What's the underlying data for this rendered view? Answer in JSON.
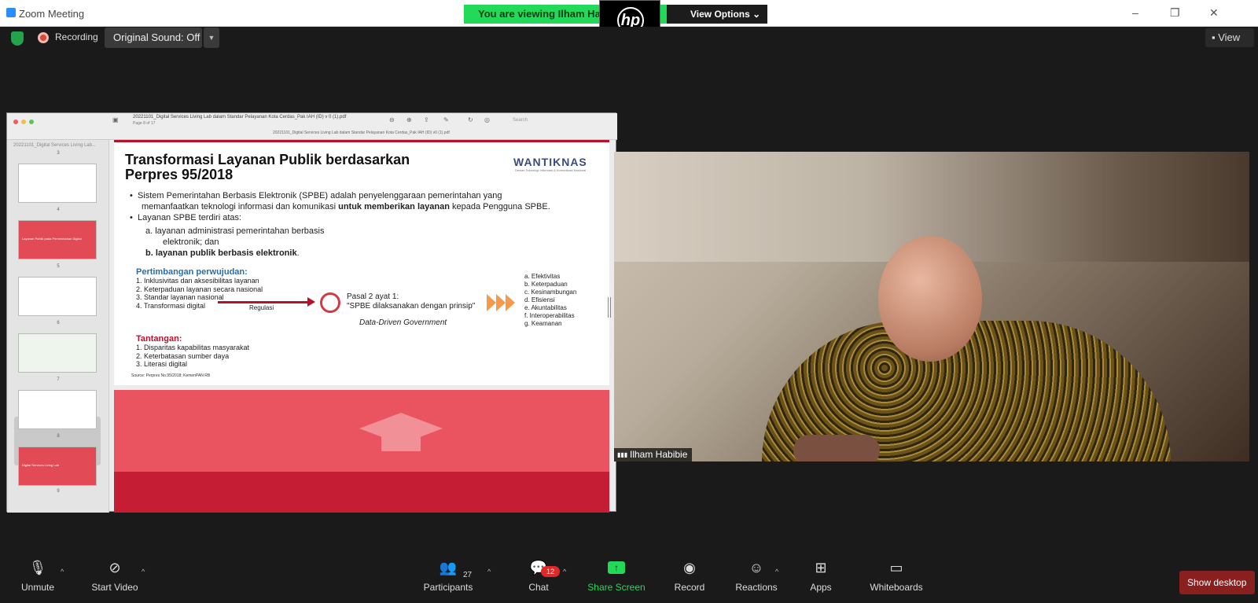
{
  "window": {
    "title": "Zoom Meeting",
    "minimize_glyph": "–",
    "restore_glyph": "❐",
    "close_glyph": "✕"
  },
  "banner": {
    "viewing_text": "You are viewing Ilham Habi",
    "view_options": "View Options ⌄",
    "hp_logo": "hp"
  },
  "meeting_bar": {
    "recording_label": "Recording",
    "original_sound": "Original Sound: Off",
    "view_label": "View"
  },
  "pdf": {
    "file_title": "20221101_Digital Services Living Lab dalam Standar Pelayanan Kota Cerdas_Pak IAH (ID) v 0 (1).pdf",
    "page_info": "Page 8 of 17",
    "file_subtitle": "20221101_Digital Services Living Lab dalam Standar Pelayanan Kota Cerdas_Pak IAH (ID) v0 (1).pdf",
    "search_placeholder": "Search",
    "sidebar_header": "20221101_Digital Services Living Lab...",
    "thumbnails": [
      {
        "page": "3",
        "label": ""
      },
      {
        "page": "4",
        "label": ""
      },
      {
        "page": "5",
        "label": "Layanan Publik pada Pemerintahan Digital"
      },
      {
        "page": "6",
        "label": ""
      },
      {
        "page": "7",
        "label": ""
      },
      {
        "page": "8",
        "label": ""
      },
      {
        "page": "9",
        "label": "Digital Services Living Lab"
      }
    ]
  },
  "slide": {
    "title_line1": "Transformasi Layanan Publik berdasarkan",
    "title_line2": "Perpres 95/2018",
    "logo": "WANTIKNAS",
    "logo_sub": "Dewan Teknologi Informasi & Komunikasi Nasional",
    "bullet1_a": "Sistem Pemerintahan Berbasis Elektronik (SPBE) adalah penyelenggaraan pemerintahan yang",
    "bullet1_b": "memanfaatkan teknologi informasi dan komunikasi",
    "bullet1_bold": "untuk memberikan layanan",
    "bullet1_c": "kepada Pengguna SPBE.",
    "bullet2": "Layanan SPBE terdiri atas:",
    "sub_a": "a.  layanan administrasi pemerintahan berbasis",
    "sub_a2": "elektronik; dan",
    "sub_b": "b.  layanan publik berbasis elektronik",
    "sub_b_end": ".",
    "pertimbangan_heading": "Pertimbangan perwujudan:",
    "pertimbangan": [
      "1. Inklusivitas dan aksesibilitas layanan",
      "2. Keterpaduan layanan secara nasional",
      "3. Standar layanan nasional",
      "4. Transformasi digital"
    ],
    "regulasi": "Regulasi",
    "pasal_line1": "Pasal 2 ayat 1:",
    "pasal_line2": "\"SPBE dilaksanakan dengan prinsip\"",
    "data_driven": "Data-Driven Government",
    "prinsip": [
      "a. Efektivitas",
      "b. Keterpaduan",
      "c. Kesinambungan",
      "d. Efisiensi",
      "e. Akuntabilitas",
      "f. Interoperabilitas",
      "g. Keamanan"
    ],
    "tantangan_heading": "Tantangan:",
    "tantangan": [
      "1. Disparitas kapabilitas masyarakat",
      "2. Keterbatasan sumber daya",
      "3. Literasi digital"
    ],
    "source": "Source: Perpres No.95/2018; KemenPAN RB"
  },
  "participant": {
    "name": "Ilham Habibie"
  },
  "toolbar": {
    "unmute": "Unmute",
    "start_video": "Start Video",
    "participants": "Participants",
    "participants_count": "27",
    "chat": "Chat",
    "chat_badge": "12",
    "share_screen": "Share Screen",
    "record": "Record",
    "reactions": "Reactions",
    "apps": "Apps",
    "whiteboards": "Whiteboards",
    "show_desktop": "Show desktop"
  },
  "colors": {
    "zoom_green": "#23d959",
    "slide_red": "#b8122b",
    "badge_red": "#e02828"
  }
}
